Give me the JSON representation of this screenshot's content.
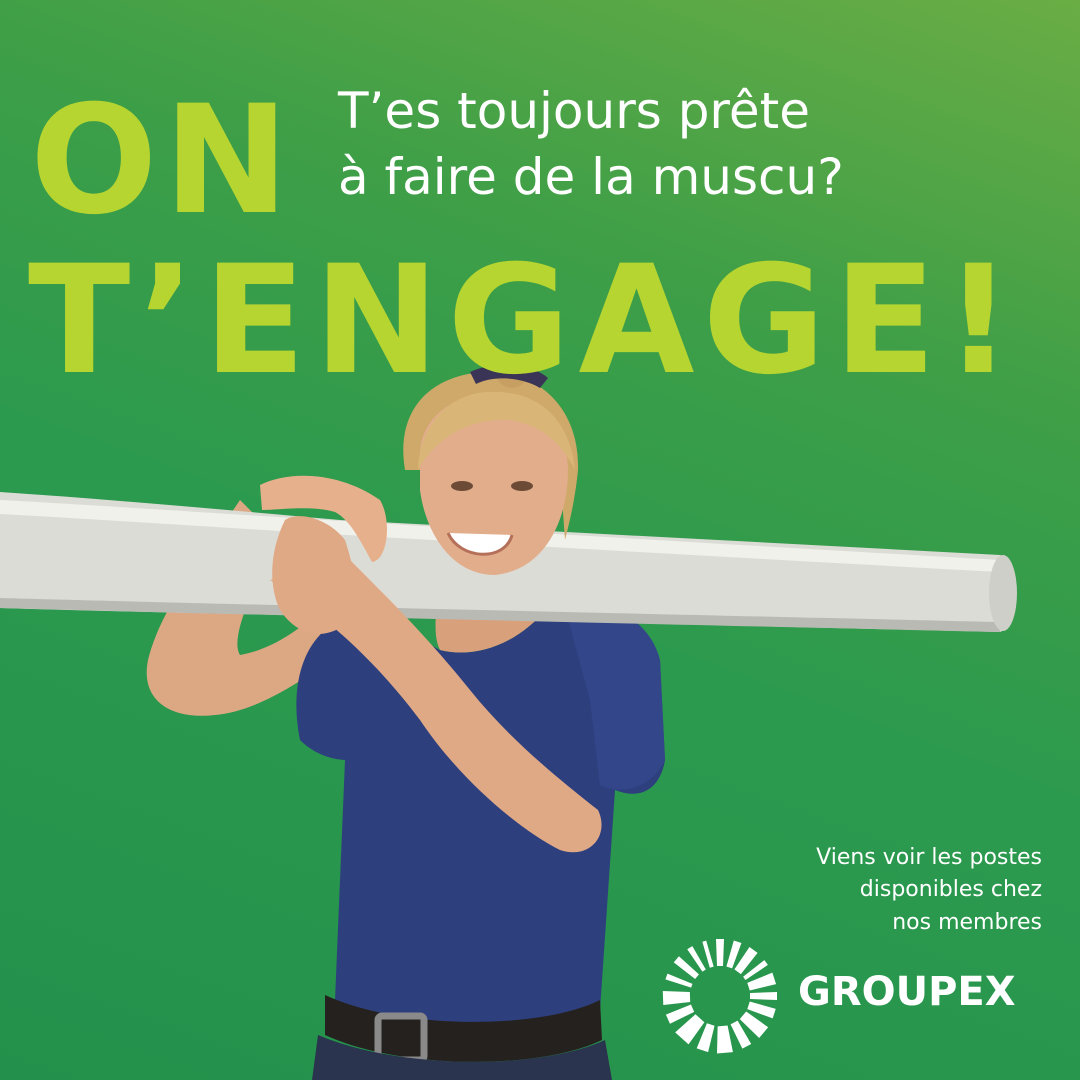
{
  "headline": {
    "line1": "ON",
    "line2": "T’ENGAGE!"
  },
  "question": {
    "line1": "T’es toujours prête",
    "line2": "à faire de la muscu?"
  },
  "cta": {
    "line1": "Viens voir les postes",
    "line2": "disponibles chez",
    "line3": "nos membres"
  },
  "brand": {
    "name": "GROUPEX"
  },
  "colors": {
    "background": "#2c9a4e",
    "headline": "#b7d531",
    "text": "#ffffff",
    "shirt": "#2e3f7e"
  },
  "icons": [
    "groupex-logo-icon"
  ]
}
